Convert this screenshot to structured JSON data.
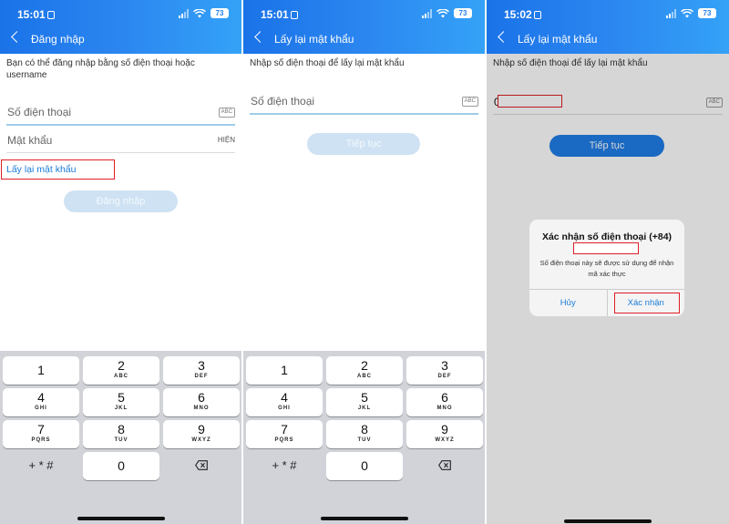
{
  "screen1": {
    "status": {
      "time": "15:01",
      "battery": "73"
    },
    "title": "Đăng nhập",
    "description": "Bạn có thể đăng nhập bằng số điện thoại hoặc username",
    "phone_placeholder": "Số điện thoại",
    "phone_tag": "ABC",
    "password_placeholder": "Mật khẩu",
    "password_toggle": "HIỆN",
    "forgot_link": "Lấy lại mật khẩu",
    "login_button": "Đăng nhập"
  },
  "screen2": {
    "status": {
      "time": "15:01",
      "battery": "73"
    },
    "title": "Lấy lại mật khẩu",
    "description": "Nhập số điện thoại để lấy lại mật khẩu",
    "phone_placeholder": "Số điện thoại",
    "phone_tag": "ABC",
    "continue_button": "Tiếp tục"
  },
  "screen3": {
    "status": {
      "time": "15:02",
      "battery": "73"
    },
    "title": "Lấy lại mật khẩu",
    "description": "Nhập số điện thoại để lấy lại mật khẩu",
    "phone_value": "0",
    "phone_tag": "ABC",
    "continue_button": "Tiếp tục",
    "dialog": {
      "title": "Xác nhận số điện thoại (+84)",
      "message": "Số điện thoại này sẽ được sử dụng để nhận mã xác thực",
      "cancel": "Hủy",
      "confirm": "Xác nhận"
    }
  },
  "keypad": {
    "keys": [
      {
        "digit": "1",
        "letters": ""
      },
      {
        "digit": "2",
        "letters": "ABC"
      },
      {
        "digit": "3",
        "letters": "DEF"
      },
      {
        "digit": "4",
        "letters": "GHI"
      },
      {
        "digit": "5",
        "letters": "JKL"
      },
      {
        "digit": "6",
        "letters": "MNO"
      },
      {
        "digit": "7",
        "letters": "PQRS"
      },
      {
        "digit": "8",
        "letters": "TUV"
      },
      {
        "digit": "9",
        "letters": "WXYZ"
      },
      {
        "digit": "0",
        "letters": ""
      }
    ],
    "symbols": "+ * #"
  }
}
